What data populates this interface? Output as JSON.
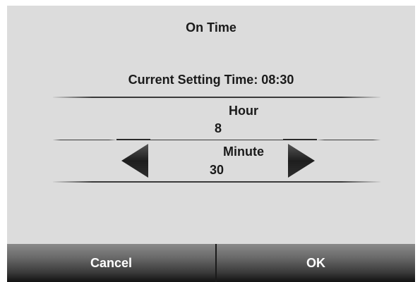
{
  "dialog": {
    "title": "On Time",
    "current_setting": "Current Setting Time: 08:30"
  },
  "hour": {
    "label": "Hour",
    "value": "8"
  },
  "minute": {
    "label": "Minute",
    "value": "30"
  },
  "buttons": {
    "cancel": "Cancel",
    "ok": "OK"
  },
  "icons": {
    "decrement": "left-arrow-icon",
    "increment": "right-arrow-icon"
  },
  "colors": {
    "panel_background": "#dcdcdc",
    "footer_dark": "#111111",
    "arrow": "#222222"
  }
}
